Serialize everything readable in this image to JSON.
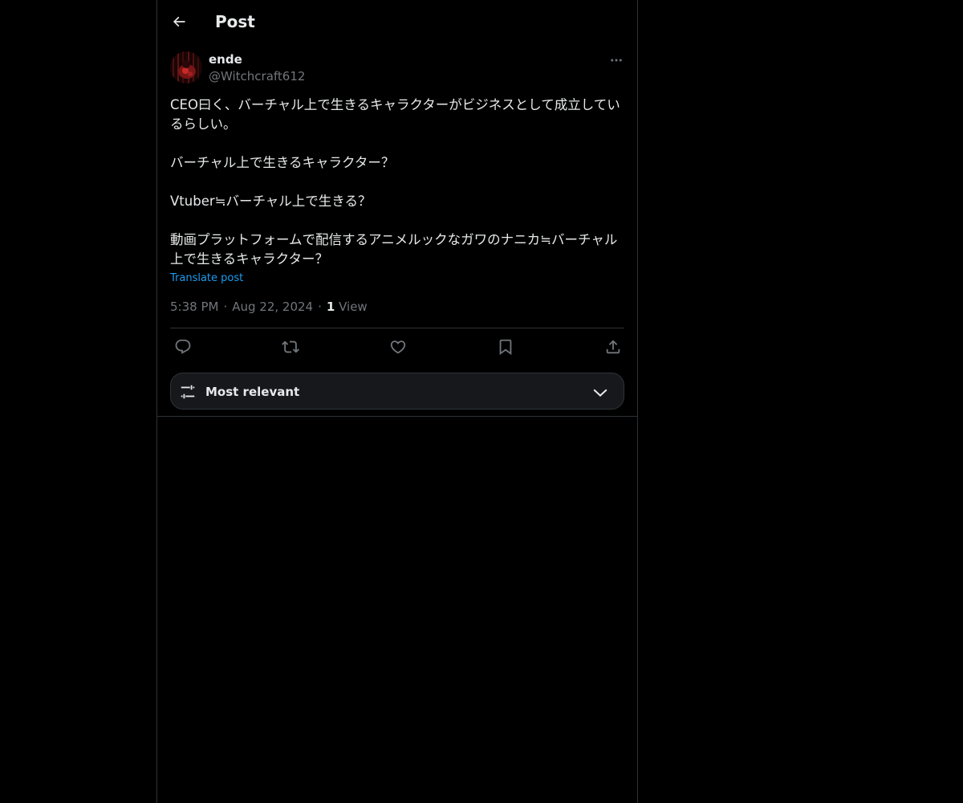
{
  "header": {
    "back_icon": "arrow-left-icon",
    "title": "Post"
  },
  "author": {
    "display_name": "ende",
    "handle": "@Witchcraft612",
    "more_icon": "more-horizontal-icon"
  },
  "post": {
    "paragraphs": [
      "CEO曰く、バーチャル上で生きるキャラクターがビジネスとして成立しているらしい。",
      "バーチャル上で生きるキャラクター？",
      "Vtuber≒バーチャル上で生きる？",
      "動画プラットフォームで配信するアニメルックなガワのナニカ≒バーチャル上で生きるキャラクター？"
    ],
    "translate_label": "Translate post",
    "time": "5:38 PM",
    "date": "Aug 22, 2024",
    "view_count": "1",
    "view_label": "View"
  },
  "actions": {
    "reply_icon": "reply-icon",
    "repost_icon": "repost-icon",
    "like_icon": "heart-icon",
    "bookmark_icon": "bookmark-icon",
    "share_icon": "share-icon"
  },
  "sort": {
    "label": "Most relevant",
    "icon": "sliders-icon",
    "chevron": "chevron-down-icon"
  },
  "colors": {
    "background": "#000000",
    "text": "#e7e9ea",
    "secondary": "#71767b",
    "link": "#1d9bf0",
    "border": "#2f3336"
  }
}
